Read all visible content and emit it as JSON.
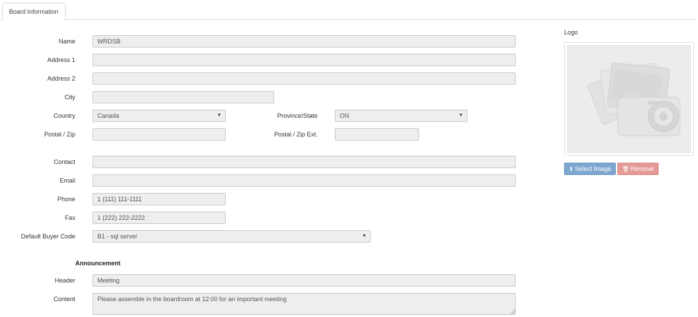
{
  "tabs": [
    {
      "label": "Board Information"
    }
  ],
  "form": {
    "name": {
      "label": "Name",
      "value": "WRDSB"
    },
    "address1": {
      "label": "Address 1",
      "value": ""
    },
    "address2": {
      "label": "Address 2",
      "value": ""
    },
    "city": {
      "label": "City",
      "value": ""
    },
    "country": {
      "label": "Country",
      "value": "Canada"
    },
    "province": {
      "label": "Province/State",
      "value": "ON"
    },
    "postal": {
      "label": "Postal / Zip",
      "value": ""
    },
    "postal_ext": {
      "label": "Postal / Zip Ext.",
      "value": ""
    },
    "contact": {
      "label": "Contact",
      "value": ""
    },
    "email": {
      "label": "Email",
      "value": ""
    },
    "phone": {
      "label": "Phone",
      "value": "1 (111) 111-1111"
    },
    "fax": {
      "label": "Fax",
      "value": "1 (222) 222-2222"
    },
    "buyer_code": {
      "label": "Default Buyer Code",
      "value": "B1 - sql server"
    }
  },
  "announcement": {
    "heading": "Announcement",
    "header": {
      "label": "Header",
      "value": "Meeting"
    },
    "content": {
      "label": "Content",
      "value": "Please assemble in the boardroom at 12:00 for an important meeting"
    }
  },
  "logo": {
    "label": "Logo",
    "select_label": "Select Image",
    "remove_label": "Remove"
  },
  "icons": {
    "select": "upload-icon",
    "remove": "trash-icon",
    "caret": "chevron-down-icon"
  },
  "colors": {
    "primary": "#7ea7cf",
    "danger": "#e49a97",
    "field_bg": "#eeeeee"
  }
}
